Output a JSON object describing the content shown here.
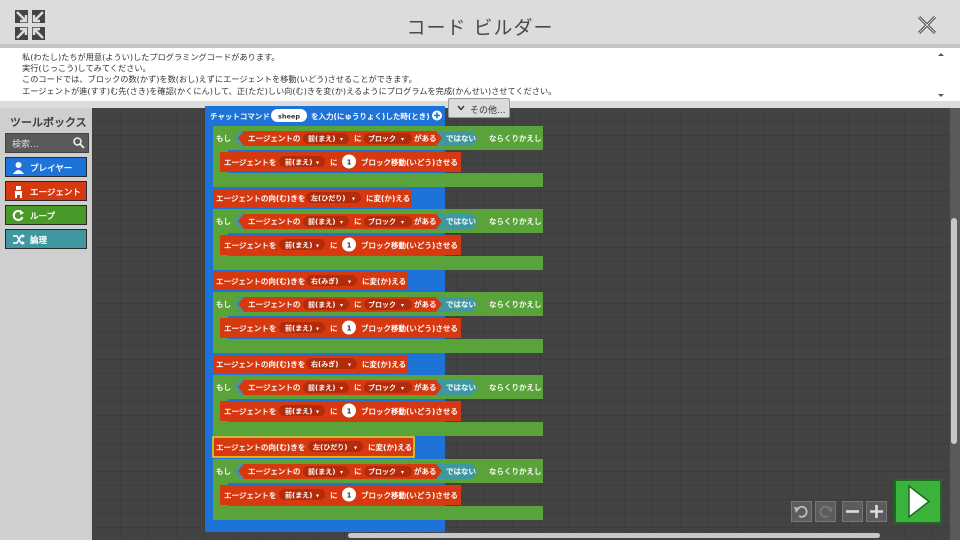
{
  "window": {
    "title": "コード ビルダー"
  },
  "instructions": {
    "lines": [
      "私(わたし)たちが用意(ようい)したプログラミングコードがあります。",
      "実行(じっこう)してみてください。",
      "このコードでは、ブロックの数(かず)を数(おし)えずにエージェントを移動(いどう)させることができます。",
      "エージェントが進(すす)む先(さき)を確認(かくにん)して、正(ただ)しい向(む)きを変(か)えるようにプログラムを完成(かんせい)させてください。"
    ]
  },
  "more_button": {
    "label": "その他..."
  },
  "toolbox": {
    "title": "ツールボックス",
    "search_placeholder": "検索...",
    "categories": [
      {
        "label": "プレイヤー",
        "icon": "player-icon",
        "color": "#1e73d8"
      },
      {
        "label": "エージェント",
        "icon": "agent-icon",
        "color": "#d6380f"
      },
      {
        "label": "ループ",
        "icon": "loop-icon",
        "color": "#4a9a2a"
      },
      {
        "label": "論理",
        "icon": "logic-icon",
        "color": "#3f97a0"
      }
    ]
  },
  "blocks": {
    "chat_command": {
      "prefix": "チャットコマンド",
      "name": "sheep",
      "suffix": "を入力(にゅうりょく)した時(とき)"
    },
    "repeat_label": "もし",
    "repeat_suffix": "ならくりかえし",
    "agent_of": "エージェントの",
    "direction_forward": "前(まえ)",
    "ni": "に",
    "block_word": "ブロック",
    "ga_aru": "がある",
    "not_label": "ではない",
    "move_prefix": "エージェントを",
    "move_count": "1",
    "move_suffix": "ブロック移動(いどう)させる",
    "turn_prefix": "エージェントの向(む)きを",
    "turn_suffix_1": "に変(か)える",
    "turn_suffix_2": "に変(か)える",
    "turn_suffix_3": "に変(か)える",
    "turn_suffix_4": "に変(か)える",
    "turn_dirs": [
      "左(ひだり)",
      "右(みぎ)",
      "右(みぎ)",
      "左(ひだり)"
    ]
  },
  "colors": {
    "event_blue": "#1e73d8",
    "loop_green": "#5aa33a",
    "agent_red": "#d6380f",
    "logic_teal": "#3f97a0",
    "run_green": "#3bb23b"
  }
}
